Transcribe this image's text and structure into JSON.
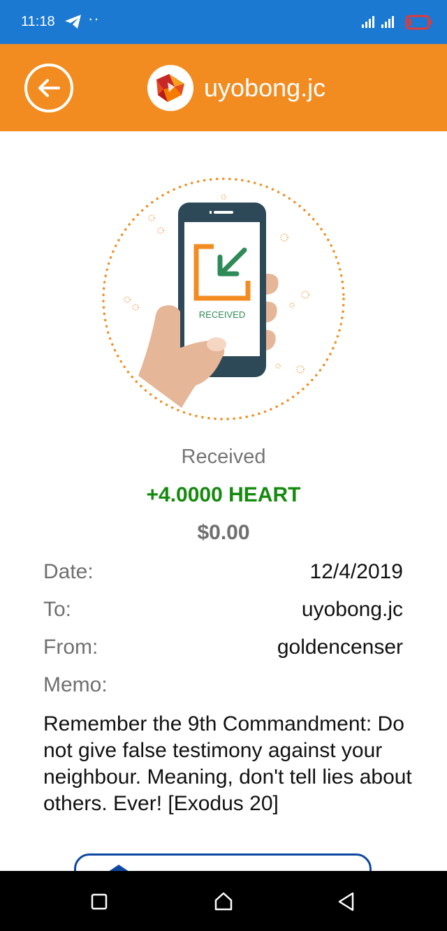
{
  "status_bar": {
    "time": "11:18",
    "dots": "··"
  },
  "header": {
    "title": "uyobong.jc"
  },
  "illustration": {
    "screen_text": "RECEIVED"
  },
  "transaction": {
    "status": "Received",
    "amount": "+4.0000 HEART",
    "usd_value": "$0.00"
  },
  "details": [
    {
      "label": "Date:",
      "value": "12/4/2019"
    },
    {
      "label": "To:",
      "value": "uyobong.jc"
    },
    {
      "label": "From:",
      "value": "goldencenser"
    },
    {
      "label": "Memo:",
      "value": ""
    }
  ],
  "memo": "Remember the 9th Commandment: Do not give false testimony against your neighbour. Meaning, don't tell lies about others. Ever! [Exodus 20]",
  "colors": {
    "status_bar": "#1c79d2",
    "header": "#f28c21",
    "amount": "#168a0f",
    "accent_orange": "#f28c21",
    "button_border": "#0d47a1"
  }
}
